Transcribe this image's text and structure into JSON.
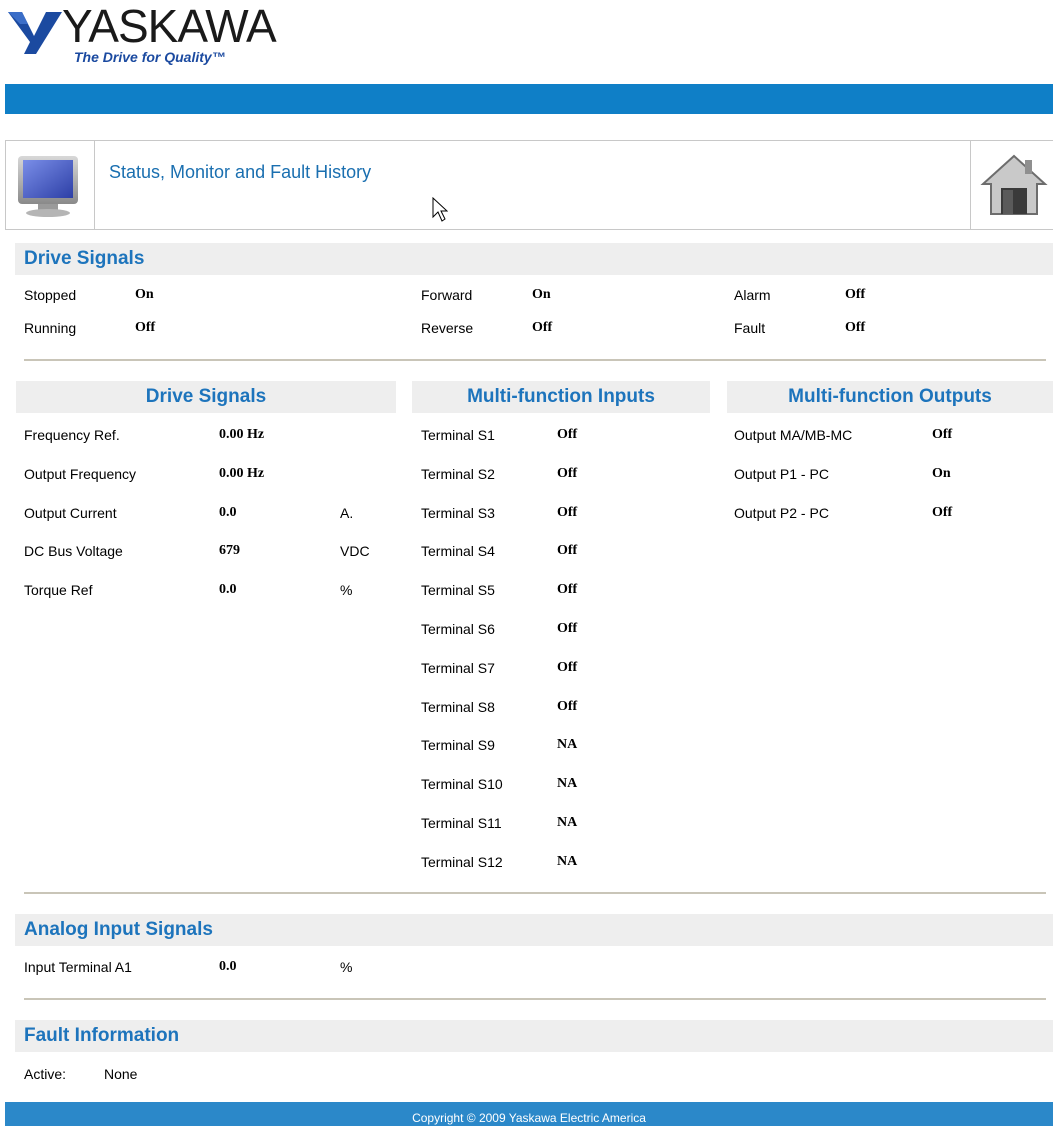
{
  "header": {
    "brand": "YASKAWA",
    "tagline": "The Drive for Quality™"
  },
  "title_panel": {
    "title": "Status, Monitor and Fault History",
    "left_icon": "monitor-icon",
    "right_icon": "home-icon"
  },
  "drive_signals_summary": {
    "heading": "Drive Signals",
    "items": [
      {
        "label": "Stopped",
        "value": "On"
      },
      {
        "label": "Running",
        "value": "Off"
      },
      {
        "label": "Forward",
        "value": "On"
      },
      {
        "label": "Reverse",
        "value": "Off"
      },
      {
        "label": "Alarm",
        "value": "Off"
      },
      {
        "label": "Fault",
        "value": "Off"
      }
    ]
  },
  "drive_signals": {
    "heading": "Drive Signals",
    "rows": [
      {
        "label": "Frequency Ref.",
        "value": "0.00 Hz",
        "unit": ""
      },
      {
        "label": "Output Frequency",
        "value": "0.00 Hz",
        "unit": ""
      },
      {
        "label": "Output Current",
        "value": "0.0",
        "unit": "A."
      },
      {
        "label": "DC Bus Voltage",
        "value": "679",
        "unit": "VDC"
      },
      {
        "label": "Torque Ref",
        "value": "0.0",
        "unit": "%"
      }
    ]
  },
  "multi_inputs": {
    "heading": "Multi-function Inputs",
    "rows": [
      {
        "label": "Terminal S1",
        "value": "Off"
      },
      {
        "label": "Terminal S2",
        "value": "Off"
      },
      {
        "label": "Terminal S3",
        "value": "Off"
      },
      {
        "label": "Terminal S4",
        "value": "Off"
      },
      {
        "label": "Terminal S5",
        "value": "Off"
      },
      {
        "label": "Terminal S6",
        "value": "Off"
      },
      {
        "label": "Terminal S7",
        "value": "Off"
      },
      {
        "label": "Terminal S8",
        "value": "Off"
      },
      {
        "label": "Terminal S9",
        "value": "NA"
      },
      {
        "label": "Terminal S10",
        "value": "NA"
      },
      {
        "label": "Terminal S11",
        "value": "NA"
      },
      {
        "label": "Terminal S12",
        "value": "NA"
      }
    ]
  },
  "multi_outputs": {
    "heading": "Multi-function Outputs",
    "rows": [
      {
        "label": "Output MA/MB-MC",
        "value": "Off"
      },
      {
        "label": "Output P1 - PC",
        "value": "On"
      },
      {
        "label": "Output P2 - PC",
        "value": "Off"
      }
    ]
  },
  "analog_inputs": {
    "heading": "Analog Input Signals",
    "rows": [
      {
        "label": "Input Terminal A1",
        "value": "0.0",
        "unit": "%"
      }
    ]
  },
  "fault_info": {
    "heading": "Fault Information",
    "active_label": "Active:",
    "active_value": "None"
  },
  "footer": {
    "copyright": "Copyright © 2009 Yaskawa Electric America"
  },
  "colors": {
    "brand_blue": "#0f7fc7",
    "heading_blue": "#1d74bc",
    "footer_blue": "#2b88c9",
    "section_bg": "#eeeeee"
  }
}
